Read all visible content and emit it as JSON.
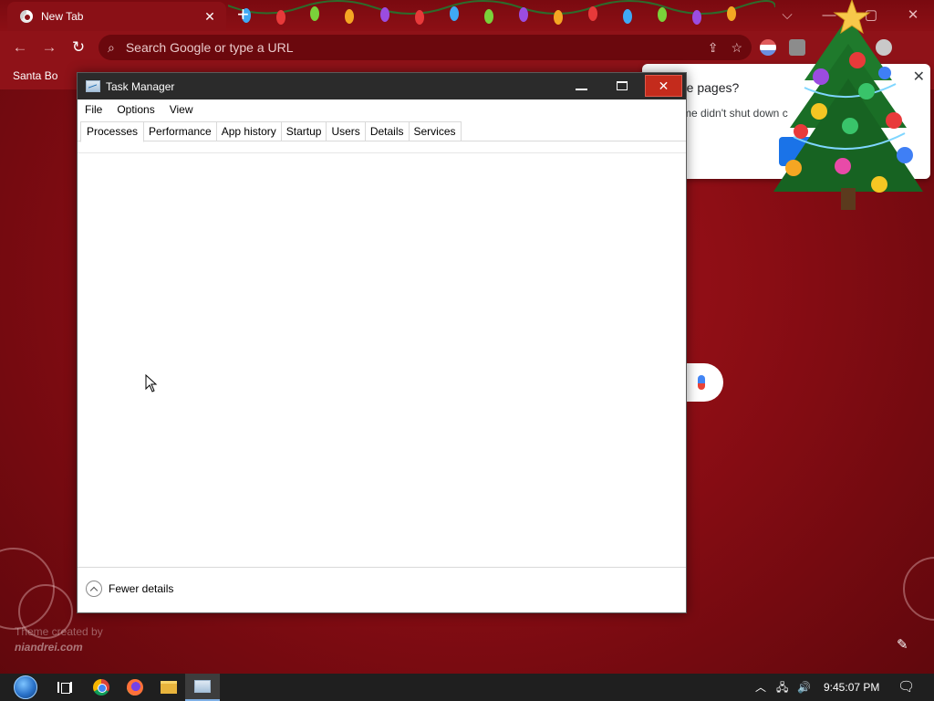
{
  "browser": {
    "tab_title": "New Tab",
    "tab_close": "✕",
    "new_tab": "+",
    "omnibox_placeholder": "Search Google or type a URL",
    "bookmark_label": "Santa Bo",
    "win_ctrl_chevron": "⌵",
    "win_ctrl_min": "—",
    "win_ctrl_max": "▢",
    "win_ctrl_close": "✕"
  },
  "restore_popup": {
    "title": "re pages?",
    "body": "me didn't shut down c",
    "close": "✕"
  },
  "task_manager": {
    "title": "Task Manager",
    "close_glyph": "✕",
    "menu": [
      "File",
      "Options",
      "View"
    ],
    "tabs": [
      "Processes",
      "Performance",
      "App history",
      "Startup",
      "Users",
      "Details",
      "Services"
    ],
    "active_tab": "Processes",
    "footer_label": "Fewer details"
  },
  "theme_credit": {
    "line1": "Theme created by",
    "line2": "niandrei.com"
  },
  "taskbar": {
    "clock": "9:45:07 PM"
  },
  "colors": {
    "background": "#8a0d14",
    "titlebar": "#2b2b2b",
    "close_button": "#c42b1c",
    "accent_blue": "#1a73e8"
  }
}
